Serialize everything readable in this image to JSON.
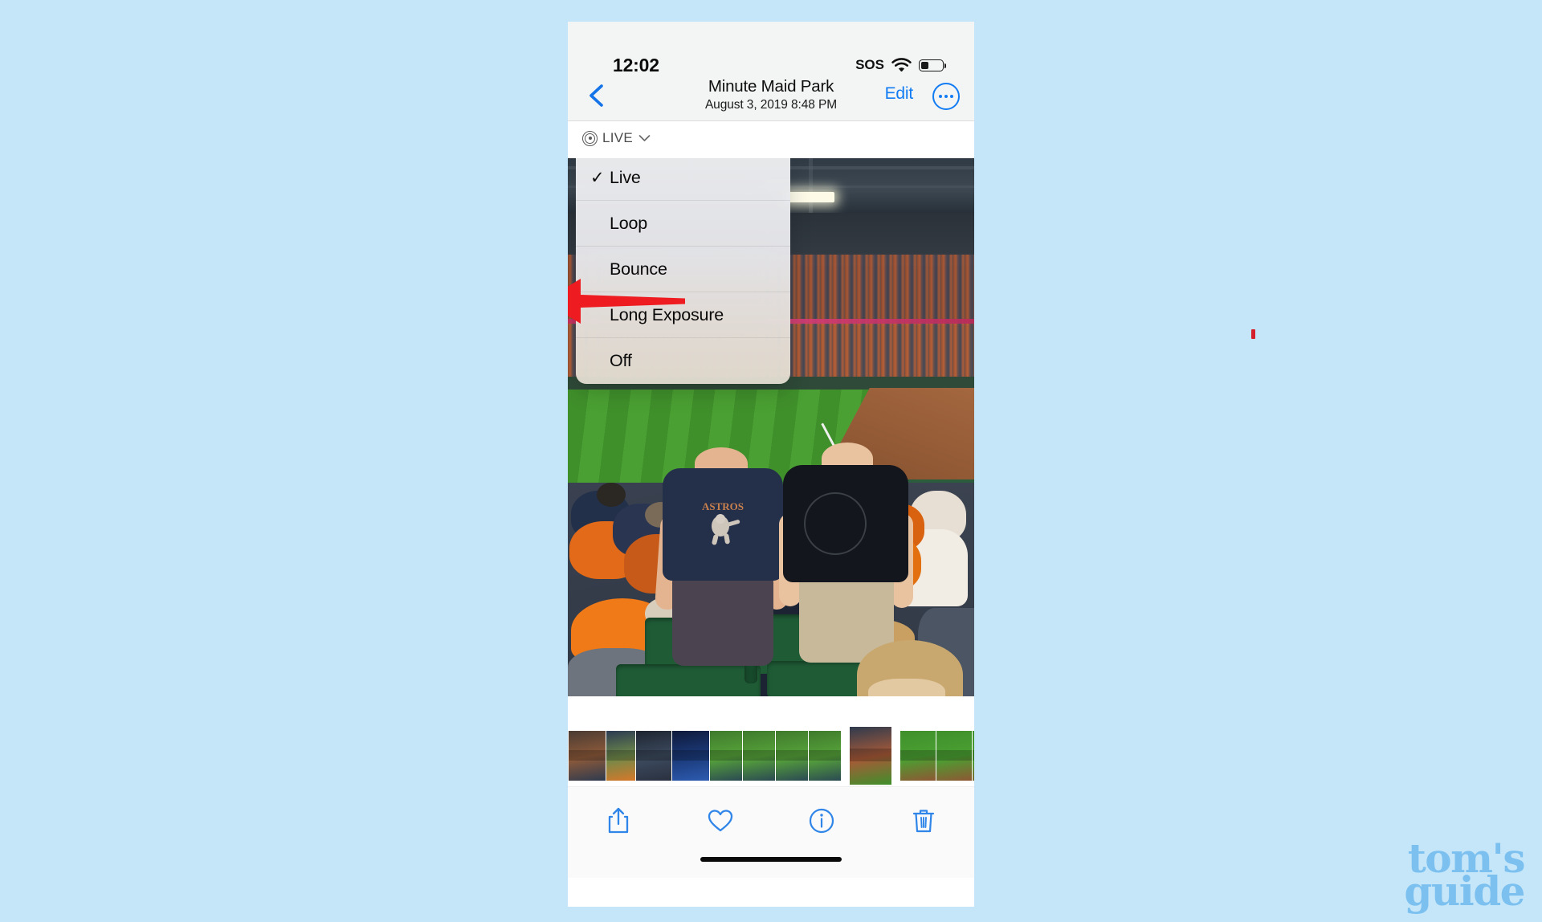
{
  "page": {
    "background_color": "#c5e6f9",
    "watermark": {
      "line1": "tom's",
      "line2": "guide",
      "color": "#7cc0f0"
    }
  },
  "phone": {
    "status_bar": {
      "time": "12:02",
      "sos_label": "SOS",
      "icons": [
        "sos-indicator",
        "wifi-icon",
        "battery-icon"
      ],
      "battery_level_percent": 25
    },
    "nav_bar": {
      "back_icon": "chevron-left-icon",
      "title": "Minute Maid Park",
      "subtitle": "August 3, 2019  8:48 PM",
      "edit_label": "Edit",
      "more_icon": "ellipsis-circle-icon",
      "accent_color": "#127cf3"
    },
    "live_badge": {
      "icon": "live-photo-icon",
      "label": "LIVE",
      "caret_icon": "chevron-down-icon",
      "expanded": true
    },
    "live_menu": {
      "visible": true,
      "selected": "Live",
      "items": [
        {
          "label": "Live",
          "checked": true
        },
        {
          "label": "Loop",
          "checked": false
        },
        {
          "label": "Bounce",
          "checked": false
        },
        {
          "label": "Long Exposure",
          "checked": false
        },
        {
          "label": "Off",
          "checked": false
        }
      ]
    },
    "photo": {
      "description": "Two men standing in green stadium seats at a baseball game, Minute Maid Park"
    },
    "filmstrip": {
      "thumbnail_count": 17,
      "selected_index": 9
    },
    "toolbar": {
      "buttons": [
        {
          "name": "share-button",
          "icon": "share-icon"
        },
        {
          "name": "favorite-button",
          "icon": "heart-icon"
        },
        {
          "name": "info-button",
          "icon": "info-circle-icon"
        },
        {
          "name": "delete-button",
          "icon": "trash-icon"
        }
      ],
      "tint_color": "#2f85e8"
    },
    "home_indicator": "home-indicator-bar"
  },
  "annotation": {
    "type": "arrow",
    "color": "#ee1b20",
    "points_to": "Off"
  }
}
